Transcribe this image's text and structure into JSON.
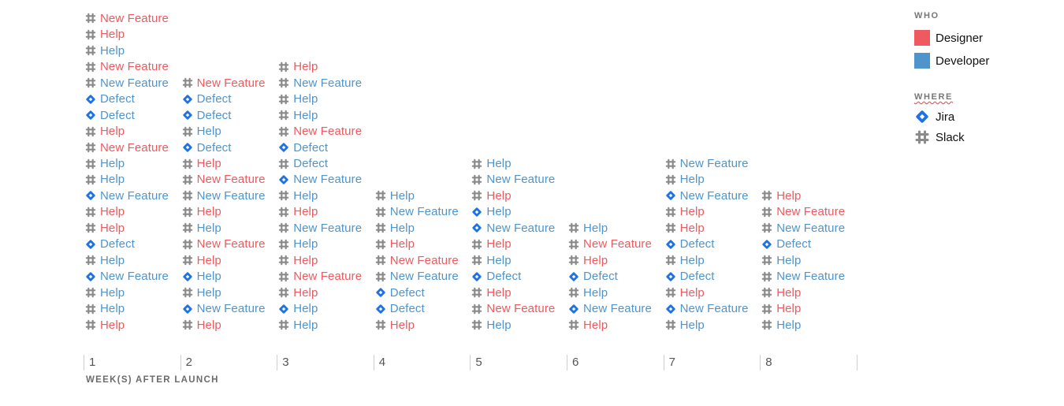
{
  "chart_data": {
    "type": "unit-stack",
    "xlabel": "WEEK(S) AFTER LAUNCH",
    "legend": {
      "who_title": "WHO",
      "who": [
        {
          "name": "Designer",
          "color": "#ee5a5f"
        },
        {
          "name": "Developer",
          "color": "#4f95cc"
        }
      ],
      "where_title": "WHERE",
      "where": [
        {
          "name": "Jira",
          "icon": "jira-icon"
        },
        {
          "name": "Slack",
          "icon": "slack-icon"
        }
      ]
    },
    "colors": {
      "Designer": "#ee5a5f",
      "Developer": "#4f95cc",
      "jira": "#1f72e6",
      "slack": "#8a8a8a"
    },
    "weeks": [
      {
        "week": "1",
        "items": [
          {
            "label": "New Feature",
            "who": "Designer",
            "source": "slack"
          },
          {
            "label": "Help",
            "who": "Designer",
            "source": "slack"
          },
          {
            "label": "Help",
            "who": "Developer",
            "source": "slack"
          },
          {
            "label": "New Feature",
            "who": "Designer",
            "source": "slack"
          },
          {
            "label": "New Feature",
            "who": "Developer",
            "source": "slack"
          },
          {
            "label": "Defect",
            "who": "Developer",
            "source": "jira"
          },
          {
            "label": "Defect",
            "who": "Developer",
            "source": "jira"
          },
          {
            "label": "Help",
            "who": "Designer",
            "source": "slack"
          },
          {
            "label": "New Feature",
            "who": "Designer",
            "source": "slack"
          },
          {
            "label": "Help",
            "who": "Developer",
            "source": "slack"
          },
          {
            "label": "Help",
            "who": "Developer",
            "source": "slack"
          },
          {
            "label": "New Feature",
            "who": "Developer",
            "source": "jira"
          },
          {
            "label": "Help",
            "who": "Designer",
            "source": "slack"
          },
          {
            "label": "Help",
            "who": "Designer",
            "source": "slack"
          },
          {
            "label": "Defect",
            "who": "Developer",
            "source": "jira"
          },
          {
            "label": "Help",
            "who": "Developer",
            "source": "slack"
          },
          {
            "label": "New Feature",
            "who": "Developer",
            "source": "jira"
          },
          {
            "label": "Help",
            "who": "Developer",
            "source": "slack"
          },
          {
            "label": "Help",
            "who": "Developer",
            "source": "slack"
          },
          {
            "label": "Help",
            "who": "Designer",
            "source": "slack"
          }
        ]
      },
      {
        "week": "2",
        "items": [
          {
            "label": "New Feature",
            "who": "Designer",
            "source": "slack"
          },
          {
            "label": "Defect",
            "who": "Developer",
            "source": "jira"
          },
          {
            "label": "Defect",
            "who": "Developer",
            "source": "jira"
          },
          {
            "label": "Help",
            "who": "Developer",
            "source": "slack"
          },
          {
            "label": "Defect",
            "who": "Developer",
            "source": "jira"
          },
          {
            "label": "Help",
            "who": "Designer",
            "source": "slack"
          },
          {
            "label": "New Feature",
            "who": "Designer",
            "source": "slack"
          },
          {
            "label": "New Feature",
            "who": "Developer",
            "source": "slack"
          },
          {
            "label": "Help",
            "who": "Designer",
            "source": "slack"
          },
          {
            "label": "Help",
            "who": "Developer",
            "source": "slack"
          },
          {
            "label": "New Feature",
            "who": "Designer",
            "source": "slack"
          },
          {
            "label": "Help",
            "who": "Designer",
            "source": "slack"
          },
          {
            "label": "Help",
            "who": "Developer",
            "source": "jira"
          },
          {
            "label": "Help",
            "who": "Developer",
            "source": "slack"
          },
          {
            "label": "New Feature",
            "who": "Developer",
            "source": "jira"
          },
          {
            "label": "Help",
            "who": "Designer",
            "source": "slack"
          }
        ]
      },
      {
        "week": "3",
        "items": [
          {
            "label": "Help",
            "who": "Designer",
            "source": "slack"
          },
          {
            "label": "New Feature",
            "who": "Developer",
            "source": "slack"
          },
          {
            "label": "Help",
            "who": "Developer",
            "source": "slack"
          },
          {
            "label": "Help",
            "who": "Developer",
            "source": "slack"
          },
          {
            "label": "New Feature",
            "who": "Designer",
            "source": "slack"
          },
          {
            "label": "Defect",
            "who": "Developer",
            "source": "jira"
          },
          {
            "label": "Defect",
            "who": "Developer",
            "source": "slack"
          },
          {
            "label": "New Feature",
            "who": "Developer",
            "source": "jira"
          },
          {
            "label": "Help",
            "who": "Developer",
            "source": "slack"
          },
          {
            "label": "Help",
            "who": "Designer",
            "source": "slack"
          },
          {
            "label": "New Feature",
            "who": "Developer",
            "source": "slack"
          },
          {
            "label": "Help",
            "who": "Developer",
            "source": "slack"
          },
          {
            "label": "Help",
            "who": "Designer",
            "source": "slack"
          },
          {
            "label": "New Feature",
            "who": "Designer",
            "source": "slack"
          },
          {
            "label": "Help",
            "who": "Designer",
            "source": "slack"
          },
          {
            "label": "Help",
            "who": "Developer",
            "source": "jira"
          },
          {
            "label": "Help",
            "who": "Developer",
            "source": "slack"
          }
        ]
      },
      {
        "week": "4",
        "items": [
          {
            "label": "Help",
            "who": "Developer",
            "source": "slack"
          },
          {
            "label": "New Feature",
            "who": "Developer",
            "source": "slack"
          },
          {
            "label": "Help",
            "who": "Developer",
            "source": "slack"
          },
          {
            "label": "Help",
            "who": "Designer",
            "source": "slack"
          },
          {
            "label": "New Feature",
            "who": "Designer",
            "source": "slack"
          },
          {
            "label": "New Feature",
            "who": "Developer",
            "source": "slack"
          },
          {
            "label": "Defect",
            "who": "Developer",
            "source": "jira"
          },
          {
            "label": "Defect",
            "who": "Developer",
            "source": "jira"
          },
          {
            "label": "Help",
            "who": "Designer",
            "source": "slack"
          }
        ]
      },
      {
        "week": "5",
        "items": [
          {
            "label": "Help",
            "who": "Developer",
            "source": "slack"
          },
          {
            "label": "New Feature",
            "who": "Developer",
            "source": "slack"
          },
          {
            "label": "Help",
            "who": "Designer",
            "source": "slack"
          },
          {
            "label": "Help",
            "who": "Developer",
            "source": "jira"
          },
          {
            "label": "New Feature",
            "who": "Developer",
            "source": "jira"
          },
          {
            "label": "Help",
            "who": "Designer",
            "source": "slack"
          },
          {
            "label": "Help",
            "who": "Developer",
            "source": "slack"
          },
          {
            "label": "Defect",
            "who": "Developer",
            "source": "jira"
          },
          {
            "label": "Help",
            "who": "Designer",
            "source": "slack"
          },
          {
            "label": "New Feature",
            "who": "Designer",
            "source": "slack"
          },
          {
            "label": "Help",
            "who": "Developer",
            "source": "slack"
          }
        ]
      },
      {
        "week": "6",
        "items": [
          {
            "label": "Help",
            "who": "Developer",
            "source": "slack"
          },
          {
            "label": "New Feature",
            "who": "Designer",
            "source": "slack"
          },
          {
            "label": "Help",
            "who": "Designer",
            "source": "slack"
          },
          {
            "label": "Defect",
            "who": "Developer",
            "source": "jira"
          },
          {
            "label": "Help",
            "who": "Developer",
            "source": "slack"
          },
          {
            "label": "New Feature",
            "who": "Developer",
            "source": "jira"
          },
          {
            "label": "Help",
            "who": "Designer",
            "source": "slack"
          }
        ]
      },
      {
        "week": "7",
        "items": [
          {
            "label": "New Feature",
            "who": "Developer",
            "source": "slack"
          },
          {
            "label": "Help",
            "who": "Developer",
            "source": "slack"
          },
          {
            "label": "New Feature",
            "who": "Developer",
            "source": "jira"
          },
          {
            "label": "Help",
            "who": "Designer",
            "source": "slack"
          },
          {
            "label": "Help",
            "who": "Designer",
            "source": "slack"
          },
          {
            "label": "Defect",
            "who": "Developer",
            "source": "jira"
          },
          {
            "label": "Help",
            "who": "Developer",
            "source": "slack"
          },
          {
            "label": "Defect",
            "who": "Developer",
            "source": "jira"
          },
          {
            "label": "Help",
            "who": "Designer",
            "source": "slack"
          },
          {
            "label": "New Feature",
            "who": "Developer",
            "source": "jira"
          },
          {
            "label": "Help",
            "who": "Developer",
            "source": "slack"
          }
        ]
      },
      {
        "week": "8",
        "items": [
          {
            "label": "Help",
            "who": "Designer",
            "source": "slack"
          },
          {
            "label": "New Feature",
            "who": "Designer",
            "source": "slack"
          },
          {
            "label": "New Feature",
            "who": "Developer",
            "source": "slack"
          },
          {
            "label": "Defect",
            "who": "Developer",
            "source": "jira"
          },
          {
            "label": "Help",
            "who": "Developer",
            "source": "slack"
          },
          {
            "label": "New Feature",
            "who": "Developer",
            "source": "slack"
          },
          {
            "label": "Help",
            "who": "Designer",
            "source": "slack"
          },
          {
            "label": "Help",
            "who": "Designer",
            "source": "slack"
          },
          {
            "label": "Help",
            "who": "Developer",
            "source": "slack"
          }
        ]
      }
    ]
  }
}
